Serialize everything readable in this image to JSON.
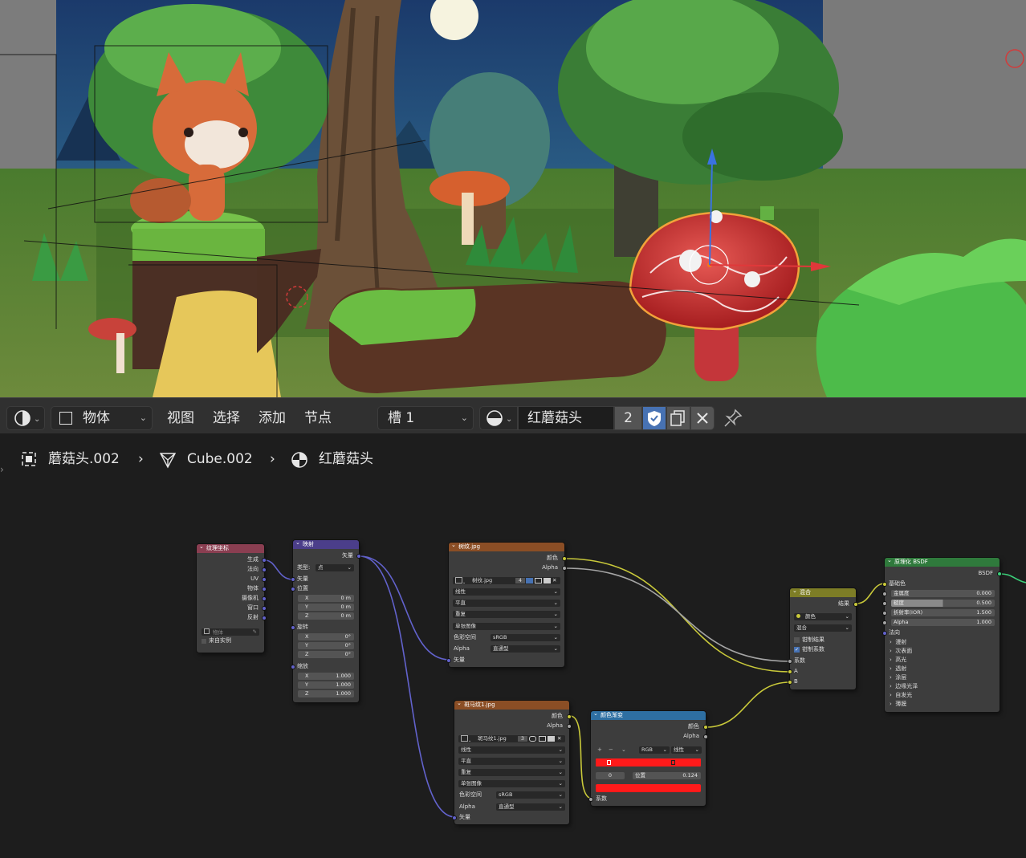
{
  "toolbar": {
    "mode": "物体",
    "menus": [
      "视图",
      "选择",
      "添加",
      "节点"
    ],
    "slot": "槽 1",
    "material": "红蘑菇头",
    "users": "2"
  },
  "breadcrumb": {
    "object": "蘑菇头.002",
    "mesh": "Cube.002",
    "material": "红蘑菇头"
  },
  "nodes": {
    "texcoord": {
      "title": "纹理坐标",
      "outputs": [
        "生成",
        "法向",
        "UV",
        "物体",
        "摄像机",
        "窗口",
        "反射"
      ],
      "object_placeholder": "物体",
      "from_instancer": "来自实例"
    },
    "mapping": {
      "title": "映射",
      "output": "矢量",
      "type_label": "类型:",
      "type_value": "点",
      "vector": "矢量",
      "location": "位置",
      "loc": [
        [
          "X",
          "0 m"
        ],
        [
          "Y",
          "0 m"
        ],
        [
          "Z",
          "0 m"
        ]
      ],
      "rotation": "旋转",
      "rot": [
        [
          "X",
          "0°"
        ],
        [
          "Y",
          "0°"
        ],
        [
          "Z",
          "0°"
        ]
      ],
      "scale": "缩放",
      "scl": [
        [
          "X",
          "1.000"
        ],
        [
          "Y",
          "1.000"
        ],
        [
          "Z",
          "1.000"
        ]
      ]
    },
    "tex1": {
      "title": "树纹.jpg",
      "out_color": "颜色",
      "out_alpha": "Alpha",
      "image": "树纹.jpg",
      "users": "4",
      "opts": [
        "线性",
        "平直",
        "重复",
        "单张图像"
      ],
      "colorspace_label": "色彩空间",
      "colorspace": "sRGB",
      "alpha_label": "Alpha",
      "alpha": "直通型",
      "vector": "矢量"
    },
    "tex2": {
      "title": "斑马纹1.jpg",
      "out_color": "颜色",
      "out_alpha": "Alpha",
      "image": "斑马纹1.jpg",
      "users": "3",
      "opts": [
        "线性",
        "平直",
        "重复",
        "单张图像"
      ],
      "colorspace_label": "色彩空间",
      "colorspace": "sRGB",
      "alpha_label": "Alpha",
      "alpha": "直通型",
      "vector": "矢量"
    },
    "ramp": {
      "title": "颜色渐变",
      "out_color": "颜色",
      "out_alpha": "Alpha",
      "mode": "RGB",
      "interp": "线性",
      "index": "0",
      "pos_label": "位置",
      "pos_value": "0.124",
      "fac": "系数",
      "color": "#ff1a1a"
    },
    "mix": {
      "title": "混合",
      "result": "结果",
      "type1": "颜色",
      "type2": "混合",
      "clamp_result": "钳制结果",
      "clamp_factor": "钳制系数",
      "fac": "系数",
      "a": "A",
      "b": "B"
    },
    "bsdf": {
      "title": "原理化 BSDF",
      "out": "BSDF",
      "base_color": "基础色",
      "props": [
        [
          "金属度",
          "0.000"
        ],
        [
          "糙度",
          "0.500"
        ],
        [
          "折射率(IOR)",
          "1.500"
        ],
        [
          "Alpha",
          "1.000"
        ]
      ],
      "normal": "法向",
      "panels": [
        "漫射",
        "次表面",
        "高光",
        "透射",
        "涂层",
        "边缘光泽",
        "自发光",
        "薄膜"
      ]
    }
  },
  "colors": {
    "texcoord_header": "#8a3e51",
    "mapping_header": "#4b3e8a",
    "texture_header": "#8b4e25",
    "ramp_header": "#2e6fa2",
    "mix_header": "#7d7d26",
    "bsdf_header": "#2f7a3c",
    "link_color": "#c9c93a",
    "link_vector": "#6262cc",
    "link_gray": "#a5a5a5",
    "link_shader": "#3bd17a"
  }
}
